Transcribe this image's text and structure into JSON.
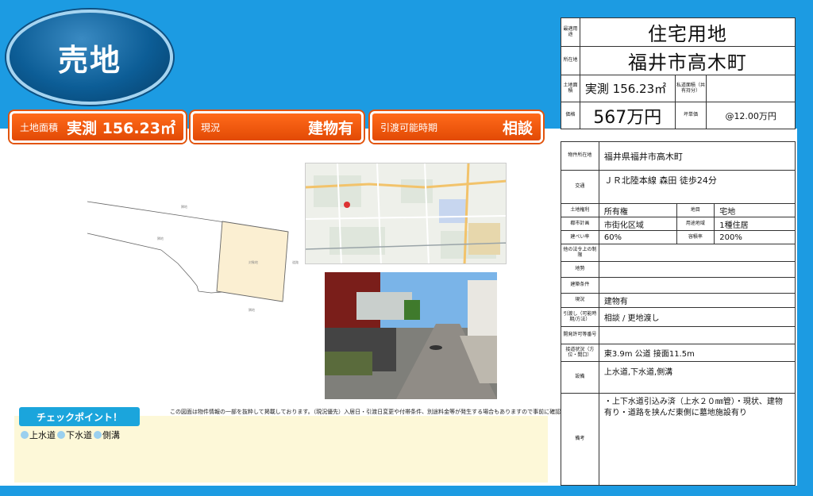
{
  "header": {
    "badge": "売地"
  },
  "pills": [
    {
      "label": "土地面積",
      "value": "実測 156.23㎡"
    },
    {
      "label": "現況",
      "value": "建物有"
    },
    {
      "label": "引渡可能時期",
      "value": "相談"
    }
  ],
  "summary": {
    "type_label": "最適用途",
    "type_value": "住宅用地",
    "location_label": "所在地",
    "location_value": "福井市高木町",
    "area_label": "土地面積",
    "area_value": "実測 156.23㎡",
    "private_road_label": "私道面積（共有持分）",
    "private_road_value": "",
    "price_label": "価格",
    "price_value": "567万円",
    "unit_price_label": "坪単価",
    "unit_price_value": "@12.00万円"
  },
  "details": {
    "address_label": "物件所在地",
    "address_value": "福井県福井市高木町",
    "transport_label": "交通",
    "transport_value": "ＪＲ北陸本線 森田 徒歩24分",
    "rows": [
      {
        "l1": "土地権利",
        "v1": "所有権",
        "l2": "地目",
        "v2": "宅地"
      },
      {
        "l1": "都市計画",
        "v1": "市街化区域",
        "l2": "用途地域",
        "v2": "1種住居"
      },
      {
        "l1": "建ぺい率",
        "v1": "60%",
        "l2": "容積率",
        "v2": "200%"
      }
    ],
    "other_law_label": "他の法令上の制限",
    "other_law_value": "",
    "sei_label": "地勢",
    "sei_value": "",
    "build_cond_label": "建築条件",
    "build_cond_value": "",
    "status_label": "現況",
    "status_value": "建物有",
    "handover_label": "引渡し（可能時期/方法）",
    "handover_value": "相談 / 更地渡し",
    "dev_label": "開発許可等番号",
    "dev_value": "",
    "road_label": "接道状況（方位・間口）",
    "road_value": "東3.9m 公道 接面11.5m",
    "facility_label": "設備",
    "facility_value": "上水道,下水道,側溝",
    "remarks_label": "備考",
    "remarks_value": "・上下水道引込み済（上水２０㎜管）・現状、建物有り・道路を挟んだ東側に墓地施設有り"
  },
  "check": {
    "title": "チェックポイント！",
    "items": [
      "上水道",
      "下水道",
      "側溝"
    ]
  },
  "note": "この図面は物件情報の一部を抜粋して掲載しております。（現況優先）入居日・引渡日変更や付帯条件、別途料金等が発生する場合もありますので事前に確認ください。"
}
